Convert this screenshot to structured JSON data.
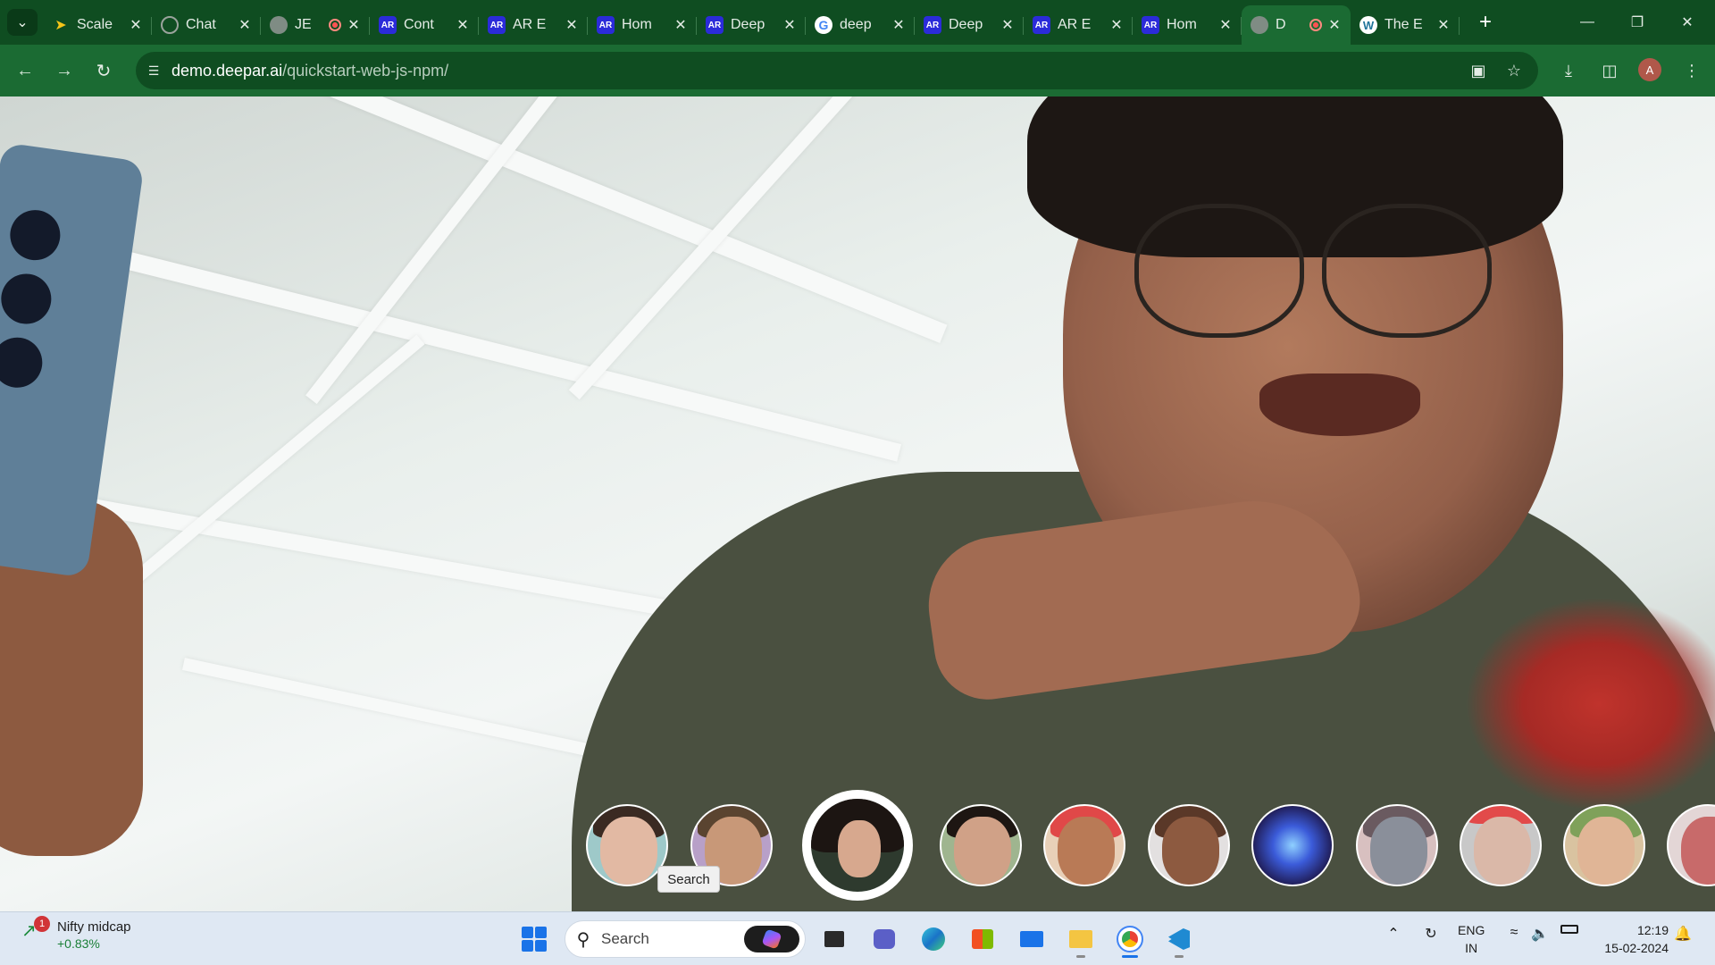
{
  "browser": {
    "tabs": [
      {
        "title": "Scale",
        "favicon": "scale-icon",
        "favicon_color": "#f5c518"
      },
      {
        "title": "Chat",
        "favicon": "chatgpt-icon",
        "favicon_color": "#9aa39c"
      },
      {
        "title": "JE",
        "favicon": "globe-icon",
        "favicon_color": "#7f8c84",
        "recording": true
      },
      {
        "title": "Cont",
        "favicon": "ar-icon",
        "favicon_color": "#2b2bd9"
      },
      {
        "title": "AR E",
        "favicon": "ar-icon",
        "favicon_color": "#2b2bd9"
      },
      {
        "title": "Hom",
        "favicon": "ar-icon",
        "favicon_color": "#2b2bd9"
      },
      {
        "title": "Deep",
        "favicon": "ar-icon",
        "favicon_color": "#2b2bd9"
      },
      {
        "title": "deep",
        "favicon": "google-icon",
        "favicon_color": "#ffffff"
      },
      {
        "title": "Deep",
        "favicon": "ar-icon",
        "favicon_color": "#2b2bd9"
      },
      {
        "title": "AR E",
        "favicon": "ar-icon",
        "favicon_color": "#2b2bd9"
      },
      {
        "title": "Hom",
        "favicon": "ar-icon",
        "favicon_color": "#2b2bd9"
      },
      {
        "title": "D",
        "favicon": "globe-icon",
        "favicon_color": "#7f8c84",
        "recording": true,
        "active": true
      },
      {
        "title": "The E",
        "favicon": "wordpress-icon",
        "favicon_color": "#ffffff"
      }
    ],
    "url_host": "demo.deepar.ai",
    "url_path": "/quickstart-web-js-npm/",
    "profile_initial": "A",
    "theme_colors": {
      "tabstrip": "#0f4d21",
      "toolbar": "#1b6b33"
    }
  },
  "filters": {
    "items": [
      {
        "name": "filter-glasses-woman"
      },
      {
        "name": "filter-cowboy-man"
      },
      {
        "name": "filter-flower-woman",
        "selected": true
      },
      {
        "name": "filter-makeup-woman"
      },
      {
        "name": "filter-face-paint-man"
      },
      {
        "name": "filter-big-smile-man"
      },
      {
        "name": "filter-galaxy"
      },
      {
        "name": "filter-robot-mask"
      },
      {
        "name": "filter-devil-horns"
      },
      {
        "name": "filter-pizza-hat"
      },
      {
        "name": "filter-clown-partial"
      }
    ],
    "tooltip": "Search"
  },
  "taskbar": {
    "widget_name": "Nifty midcap",
    "widget_change": "+0.83%",
    "widget_badge": "1",
    "search_label": "Search",
    "lang_line1": "ENG",
    "lang_line2": "IN",
    "time": "12:19",
    "date": "15-02-2024"
  }
}
